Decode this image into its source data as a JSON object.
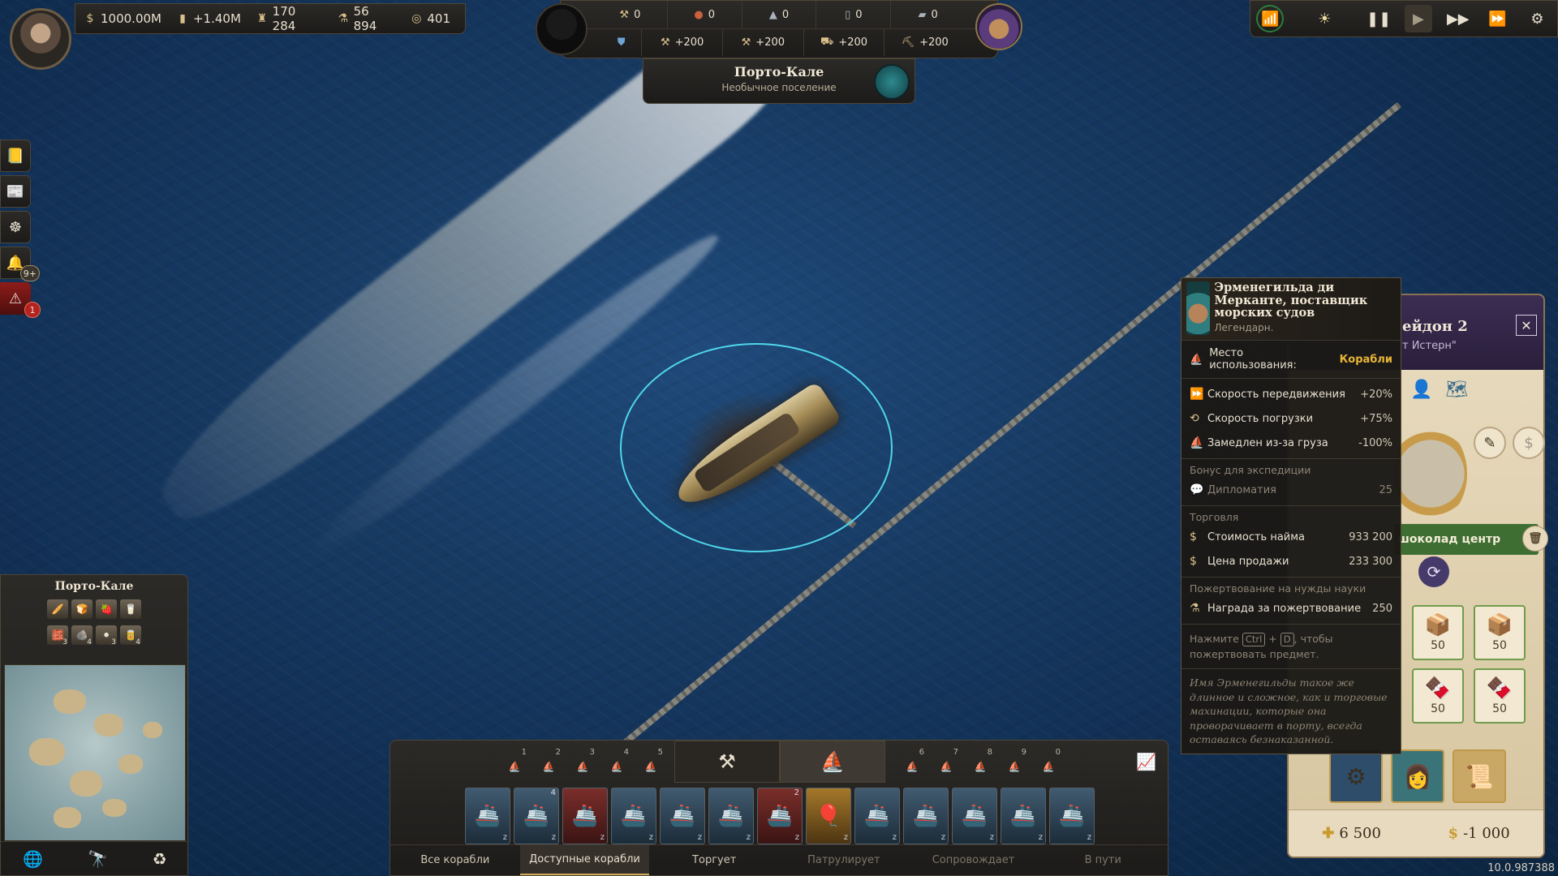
{
  "top_resources": {
    "money": "1000.00M",
    "balance": "+1.40M",
    "population": "170 284",
    "research": "56 894",
    "influence": "401"
  },
  "top_center": {
    "goods": [
      {
        "icon": "cannon-icon",
        "value": "0"
      },
      {
        "icon": "meat-icon",
        "value": "0"
      },
      {
        "icon": "anvil-icon",
        "value": "0"
      },
      {
        "icon": "barrel-icon",
        "value": "0"
      },
      {
        "icon": "crate-icon",
        "value": "0"
      }
    ],
    "bonuses": [
      {
        "icon": "wrench-icon",
        "value": "+200"
      },
      {
        "icon": "hammer-icon",
        "value": "+200"
      },
      {
        "icon": "cart-icon",
        "value": "+200"
      },
      {
        "icon": "pickaxe-icon",
        "value": "+200"
      }
    ]
  },
  "settlement": {
    "name": "Порто-Кале",
    "type": "Необычное поселение"
  },
  "left_sidebar": {
    "notifications_badge": "9+",
    "alerts_badge": "1"
  },
  "minimap": {
    "title": "Порто-Кале",
    "goods_top": [
      "🥖",
      "🍞",
      "🍓",
      "🥛"
    ],
    "goods_bottom": [
      {
        "glyph": "🧱",
        "count": "3"
      },
      {
        "glyph": "🪨",
        "count": "4"
      },
      {
        "glyph": "⚫",
        "count": "3"
      },
      {
        "glyph": "🥫",
        "count": "4"
      }
    ]
  },
  "ship_bar": {
    "left_slots": [
      "1",
      "2",
      "3",
      "4",
      "5"
    ],
    "right_slots": [
      "6",
      "7",
      "8",
      "9",
      "0"
    ],
    "ship_counts": [
      "",
      "4",
      "",
      "",
      "",
      "",
      "2",
      "",
      "",
      "",
      "",
      "",
      ""
    ],
    "filters": [
      "Все корабли",
      "Доступные корабли",
      "Торгует",
      "Патрулирует",
      "Сопровождает",
      "В пути"
    ]
  },
  "right_panel": {
    "title_partial": "ейдон 2",
    "subtitle_partial": "т Истерн\"",
    "route_label": "шоколад центр",
    "cargo": [
      {
        "glyph": "📦",
        "qty": "50"
      },
      {
        "glyph": "📦",
        "qty": "50"
      },
      {
        "glyph": "🍫",
        "qty": "50"
      },
      {
        "glyph": "🍫",
        "qty": "50"
      }
    ],
    "footer_plus": "6 500",
    "footer_cost": "-1 000"
  },
  "tooltip": {
    "name": "Эрменегильда ди Мерканте, поставщик морских судов",
    "rarity": "Легендарн.",
    "use_label": "Место использования:",
    "use_value": "Корабли",
    "stats": [
      {
        "icon": "speed-icon",
        "label": "Скорость передвижения",
        "value": "+20%"
      },
      {
        "icon": "loading-icon",
        "label": "Скорость погрузки",
        "value": "+75%"
      },
      {
        "icon": "cargo-slow-icon",
        "label": "Замедлен из-за груза",
        "value": "-100%"
      }
    ],
    "expedition_section": "Бонус для экспедиции",
    "expedition": {
      "label": "Дипломатия",
      "value": "25"
    },
    "trade_section": "Торговля",
    "trade": [
      {
        "label": "Стоимость найма",
        "value": "933 200"
      },
      {
        "label": "Цена продажи",
        "value": "233 300"
      }
    ],
    "science_section": "Пожертвование на нужды науки",
    "science": {
      "label": "Награда за пожертвование",
      "value": "250"
    },
    "hint_prefix": "Нажмите",
    "hint_key1": "Ctrl",
    "hint_plus": "+",
    "hint_key2": "D",
    "hint_suffix": ", чтобы пожертвовать предмет.",
    "flavor": "Имя Эрменегильды такое же длинное и сложное, как и торговые махинации, которые она проворачивает в порту, всегда оставаясь безнаказанной."
  },
  "version": "10.0.987388"
}
